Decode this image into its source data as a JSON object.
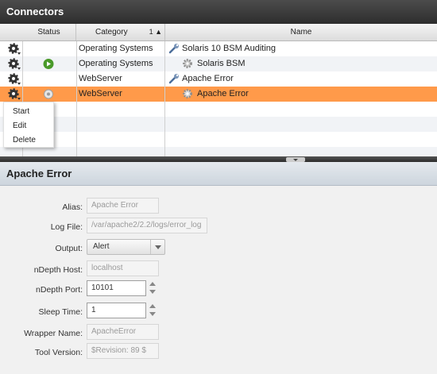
{
  "panel_title": "Connectors",
  "columns": {
    "status": "Status",
    "category": "Category",
    "sort_indicator": "1 ▲",
    "name": "Name"
  },
  "rows": [
    {
      "category": "Operating Systems",
      "name": "Solaris 10 BSM Auditing",
      "name_icon": "wrench-icon",
      "status_icon": ""
    },
    {
      "category": "Operating Systems",
      "name": "Solaris BSM",
      "name_icon": "cog-icon",
      "status_icon": "running-status-icon"
    },
    {
      "category": "WebServer",
      "name": "Apache Error",
      "name_icon": "wrench-icon",
      "status_icon": ""
    },
    {
      "category": "WebServer",
      "name": "Apache Error",
      "name_icon": "cog-icon",
      "status_icon": "stopped-status-icon"
    }
  ],
  "context_menu": {
    "items": [
      "Start",
      "Edit",
      "Delete"
    ]
  },
  "detail": {
    "title": "Apache Error",
    "alias_label": "Alias:",
    "alias_value": "Apache Error",
    "logfile_label": "Log File:",
    "logfile_value": "/var/apache2/2.2/logs/error_log",
    "output_label": "Output:",
    "output_value": "Alert",
    "ndepth_host_label": "nDepth Host:",
    "ndepth_host_value": "localhost",
    "ndepth_port_label": "nDepth Port:",
    "ndepth_port_value": "10101",
    "sleep_label": "Sleep Time:",
    "sleep_value": "1",
    "wrapper_label": "Wrapper Name:",
    "wrapper_value": "ApacheError",
    "toolver_label": "Tool Version:",
    "toolver_value": "$Revision: 89 $"
  },
  "colors": {
    "selected_row": "#ff9a4a",
    "title_bar": "#3a3a3a",
    "running_status": "#4a9a2a"
  }
}
